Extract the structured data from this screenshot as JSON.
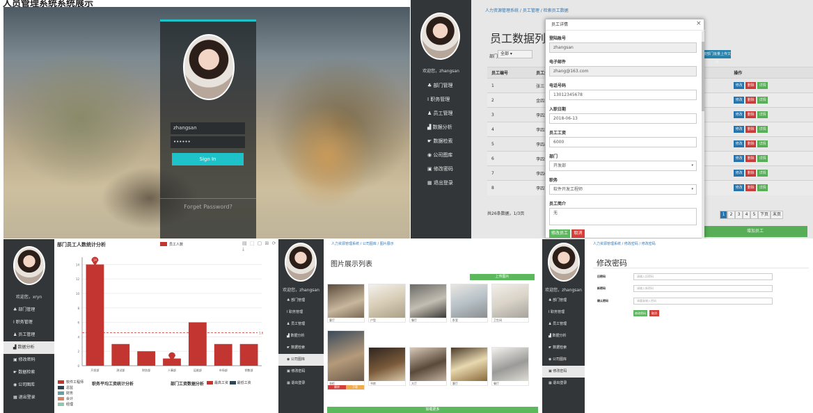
{
  "heading": "人员管理系统系统展示",
  "login": {
    "username": "zhangsan",
    "password_mask": "••••••",
    "signin_label": "Sign In",
    "forgot_label": "Forget Password?"
  },
  "sidebar": {
    "welcome_zhangsan": "欢迎您，zhangsan",
    "welcome_xryn": "欢迎您，xryn",
    "items": [
      "部门管理",
      "职务管理",
      "员工管理",
      "数据分析",
      "数据检索",
      "公司图库",
      "修改密码",
      "退出登录"
    ],
    "icons": [
      "users-icon",
      "briefcase-icon",
      "user-icon",
      "bar-chart-icon",
      "search-icon",
      "image-icon",
      "key-icon",
      "logout-icon"
    ]
  },
  "employee_list": {
    "breadcrumb": "人力资源管理系统 / 员工管理 / 检索员工数据",
    "title": "员工数据列表",
    "dept_label": "部门",
    "dept_value": "全部",
    "upload_label": "按部门批量上传文档",
    "columns": [
      "员工编号",
      "员工姓名",
      "操作"
    ],
    "rows": [
      {
        "id": "1",
        "name": "张三"
      },
      {
        "id": "2",
        "name": "金四1"
      },
      {
        "id": "3",
        "name": "李四2"
      },
      {
        "id": "4",
        "name": "李四3"
      },
      {
        "id": "5",
        "name": "李四4"
      },
      {
        "id": "6",
        "name": "李四5"
      },
      {
        "id": "7",
        "name": "李四6"
      },
      {
        "id": "8",
        "name": "李四7"
      }
    ],
    "action_edit": "修改",
    "action_delete": "删除",
    "action_detail": "详情",
    "total": "共26条数据，1/3页",
    "pages": [
      "1",
      "2",
      "3",
      "4",
      "5",
      "下页",
      "末页"
    ],
    "export_label": "增加员工"
  },
  "modal": {
    "title": "员工详情",
    "close": "×",
    "fields": [
      {
        "label": "登陆账号",
        "value": "zhangsan"
      },
      {
        "label": "电子邮件",
        "value": "zhang@163.com"
      },
      {
        "label": "电话号码",
        "value": "13012345678"
      },
      {
        "label": "入职日期",
        "value": "2018-06-13"
      },
      {
        "label": "员工工资",
        "value": "6000"
      },
      {
        "label": "部门",
        "value": "开发部"
      },
      {
        "label": "职务",
        "value": "软件开发工程师"
      },
      {
        "label": "员工简介",
        "value": "无"
      }
    ],
    "save_label": "修改员工",
    "cancel_label": "取消"
  },
  "chart": {
    "title": "部门员工人数统计分析",
    "legend": "员工人数",
    "tools": "▤ ⬚ ▢ ⊞ ⟳ ⤓",
    "title2": "职务平均工资统计分析",
    "title3": "部门工资数据分析",
    "legend3": [
      "最高工资",
      "最低工资"
    ],
    "legend2": [
      "软件工程师",
      "总监",
      "财务",
      "会计",
      "经理"
    ],
    "avg_label": "1.67"
  },
  "chart_data": {
    "type": "bar",
    "title": "部门员工人数统计分析",
    "categories": [
      "开发部",
      "测试部",
      "财务部",
      "人事部",
      "运维部",
      "市场部",
      "销售部"
    ],
    "series": [
      {
        "name": "员工人数",
        "values": [
          14,
          3,
          2,
          1,
          6,
          3,
          3
        ]
      }
    ],
    "max_marker": 14,
    "min_marker": 1,
    "average": 4.57,
    "ylim": [
      0,
      15
    ],
    "yticks": [
      0,
      2,
      4,
      6,
      8,
      10,
      12,
      14
    ],
    "color": "#c23531"
  },
  "gallery": {
    "breadcrumb": "人力资源管理系统 / 公司图库 / 图片展示",
    "title": "图片展示列表",
    "upload_label": "上传图片",
    "more_label": "加载更多",
    "captions": [
      "客厅",
      "户型",
      "餐厅",
      "卧室",
      "卫生间",
      "衣柜",
      "书房",
      "大厅",
      "客厅",
      "餐厅"
    ],
    "edit_label": "删除",
    "delete_label": "下载"
  },
  "password": {
    "breadcrumb": "人力资源管理系统 / 修改密码 / 修改密码",
    "title": "修改密码",
    "old_label": "旧密码",
    "old_placeholder": "请输入旧密码",
    "new_label": "新密码",
    "new_placeholder": "请输入新密码",
    "confirm_label": "确认密码",
    "confirm_placeholder": "请重复输入密码",
    "submit_label": "修改密码",
    "cancel_label": "取消"
  },
  "colors": {
    "accent": "#1ec3c9",
    "sidebar": "#333638",
    "primary": "#2a7ab6",
    "danger": "#d43f3a",
    "success": "#5cb85c",
    "bar": "#c23531"
  }
}
